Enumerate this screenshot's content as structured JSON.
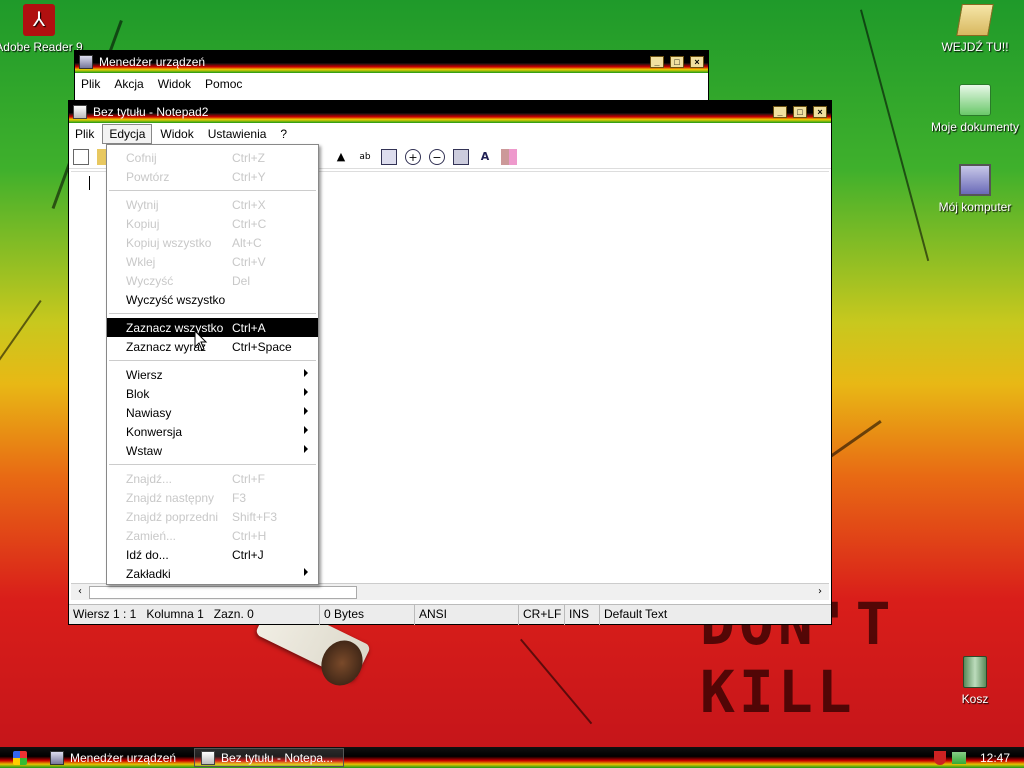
{
  "desktop": {
    "icons": {
      "adobe": "Adobe Reader 9",
      "wejdz": "WEJDŹ TU!!",
      "moje": "Moje dokumenty",
      "komputer": "Mój komputer",
      "kosz": "Kosz"
    },
    "wallpaper_text": "DON'T KILL"
  },
  "device_manager": {
    "title": "Menedżer urządzeń",
    "menu": [
      "Plik",
      "Akcja",
      "Widok",
      "Pomoc"
    ]
  },
  "notepad": {
    "title": "Bez tytułu - Notepad2",
    "menu": [
      "Plik",
      "Edycja",
      "Widok",
      "Ustawienia",
      "?"
    ],
    "status": {
      "position": "Wiersz 1 : 1",
      "column": "Kolumna 1",
      "selection": "Zazn. 0",
      "size": "0 Bytes",
      "encoding": "ANSI",
      "eol": "CR+LF",
      "mode": "INS",
      "scheme": "Default Text"
    }
  },
  "edit_menu": {
    "cofnij": {
      "label": "Cofnij",
      "shortcut": "Ctrl+Z"
    },
    "powtorz": {
      "label": "Powtórz",
      "shortcut": "Ctrl+Y"
    },
    "wytnij": {
      "label": "Wytnij",
      "shortcut": "Ctrl+X"
    },
    "kopiuj": {
      "label": "Kopiuj",
      "shortcut": "Ctrl+C"
    },
    "kopiuj_wszystko": {
      "label": "Kopiuj wszystko",
      "shortcut": "Alt+C"
    },
    "wklej": {
      "label": "Wklej",
      "shortcut": "Ctrl+V"
    },
    "wyczysc": {
      "label": "Wyczyść",
      "shortcut": "Del"
    },
    "wyczysc_wszystko": {
      "label": "Wyczyść wszystko",
      "shortcut": ""
    },
    "zaznacz_wszystko": {
      "label": "Zaznacz wszystko",
      "shortcut": "Ctrl+A"
    },
    "zaznacz_wyraz": {
      "label": "Zaznacz wyraz",
      "shortcut": "Ctrl+Space"
    },
    "wiersz": {
      "label": "Wiersz"
    },
    "blok": {
      "label": "Blok"
    },
    "nawiasy": {
      "label": "Nawiasy"
    },
    "konwersja": {
      "label": "Konwersja"
    },
    "wstaw": {
      "label": "Wstaw"
    },
    "znajdz": {
      "label": "Znajdź...",
      "shortcut": "Ctrl+F"
    },
    "znajdz_nastepny": {
      "label": "Znajdź następny",
      "shortcut": "F3"
    },
    "znajdz_poprzedni": {
      "label": "Znajdź poprzedni",
      "shortcut": "Shift+F3"
    },
    "zamien": {
      "label": "Zamień...",
      "shortcut": "Ctrl+H"
    },
    "idz_do": {
      "label": "Idź do...",
      "shortcut": "Ctrl+J"
    },
    "zakladki": {
      "label": "Zakładki"
    }
  },
  "taskbar": {
    "tasks": [
      "Menedżer urządzeń",
      "Bez tytułu - Notepa..."
    ],
    "clock": "12:47"
  }
}
